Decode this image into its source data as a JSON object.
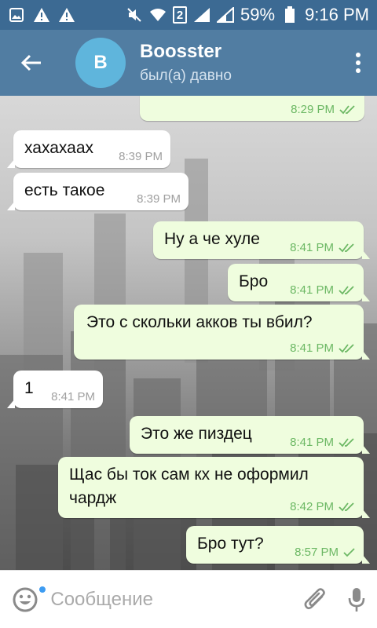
{
  "status_bar": {
    "battery_percent": "59%",
    "time": "9:16 PM",
    "sim_badge": "2",
    "icons": [
      "image-icon",
      "warning-icon",
      "warning-icon",
      "mute-icon",
      "wifi-icon",
      "sim-2-icon",
      "signal-icon",
      "signal-icon",
      "battery-icon"
    ]
  },
  "header": {
    "avatar_letter": "B",
    "title": "Boosster",
    "status": "был(а) давно",
    "colors": {
      "bar": "#517da2",
      "status_bar": "#3c6a93",
      "avatar": "#5fb5dc"
    }
  },
  "messages": [
    {
      "dir": "out",
      "text": "",
      "time": "8:29 PM",
      "read": true
    },
    {
      "dir": "in",
      "text": "хахахаах",
      "time": "8:39 PM"
    },
    {
      "dir": "in",
      "text": "есть такое",
      "time": "8:39 PM"
    },
    {
      "dir": "out",
      "text": "Ну а че хуле",
      "time": "8:41 PM",
      "read": true
    },
    {
      "dir": "out",
      "text": "Бро",
      "time": "8:41 PM",
      "read": true
    },
    {
      "dir": "out",
      "text": "Это с скольки акков ты вбил?",
      "time": "8:41 PM",
      "read": true
    },
    {
      "dir": "in",
      "text": "1",
      "time": "8:41 PM"
    },
    {
      "dir": "out",
      "text": "Это же пиздец",
      "time": "8:41 PM",
      "read": true
    },
    {
      "dir": "out",
      "text": "Щас бы ток сам кх не оформил\nчардж",
      "time": "8:42 PM",
      "read": true
    },
    {
      "dir": "out",
      "text": "Бро тут?",
      "time": "8:57 PM",
      "read": false
    }
  ],
  "input": {
    "placeholder": "Сообщение"
  }
}
